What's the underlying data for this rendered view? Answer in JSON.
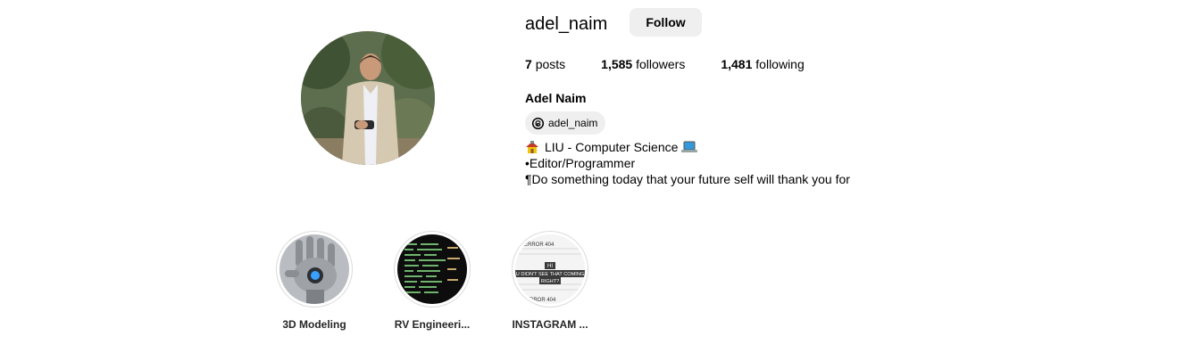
{
  "profile": {
    "username": "adel_naim",
    "follow_label": "Follow",
    "full_name": "Adel Naim",
    "threads_handle": "adel_naim"
  },
  "stats": {
    "posts_count": "7",
    "posts_label": "posts",
    "followers_count": "1,585",
    "followers_label": "followers",
    "following_count": "1,481",
    "following_label": "following"
  },
  "bio": {
    "line1": "LIU - Computer Science",
    "line2": "•Editor/Programmer",
    "line3": "¶Do something today that your future self will thank you for"
  },
  "highlights": [
    {
      "label": "3D Modeling",
      "icon": "robot-hand-image"
    },
    {
      "label": "RV Engineeri...",
      "icon": "code-screen-image"
    },
    {
      "label": "INSTAGRAM ...",
      "icon": "error-404-meme-image"
    }
  ],
  "highlight_image_text": {
    "error_top": "ERROR 404",
    "meme_line1": "HI",
    "meme_line2": "U DIDN'T SEE THAT COMING",
    "meme_line3": "RIGHT?",
    "error_bottom": "ERROR 404"
  },
  "icons": {
    "threads": "threads-icon",
    "bio_line1_leading": "house-emoji-icon",
    "bio_line1_trailing": "laptop-emoji-icon"
  },
  "colors": {
    "button_bg": "#efefef",
    "text_primary": "#000000",
    "ring_border": "#dbdbdb"
  }
}
